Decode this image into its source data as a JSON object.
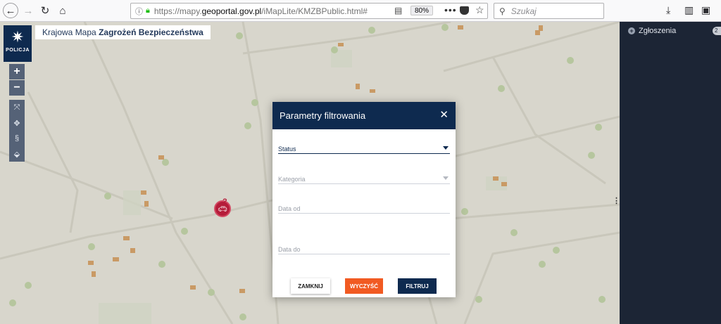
{
  "browser": {
    "url_prefix": "https://mapy.",
    "url_host": "geoportal.gov.pl",
    "url_path": "/iMapLite/KMZBPublic.html#",
    "zoom": "80%",
    "search_placeholder": "Szukaj"
  },
  "app": {
    "logo_text": "POLICJA",
    "title_light": "Krajowa Mapa",
    "title_bold": "Zagrożeń Bezpieczeństwa",
    "zoom_in": "+",
    "zoom_out": "−",
    "tools": [
      "full-extent-icon",
      "pan-icon",
      "legal-icon",
      "tag-icon"
    ],
    "tool_glyphs": [
      "⤧",
      "✥",
      "§",
      "⬙"
    ]
  },
  "side_panel": {
    "reports_label": "Zgłoszenia",
    "reports_count": "2"
  },
  "dialog": {
    "title": "Parametry filtrowania",
    "fields": {
      "status": "Status",
      "category": "Kategoria",
      "date_from": "Data od",
      "date_to": "Data do"
    },
    "buttons": {
      "close": "ZAMKNIJ",
      "clear": "WYCZYŚĆ",
      "filter": "FILTRUJ"
    }
  },
  "colors": {
    "brand_navy": "#0e2a4f",
    "clear_orange": "#f15a22",
    "marker_red": "#b51d3a",
    "side_panel": "#1c2535",
    "map_bg": "#d8d6cc"
  }
}
